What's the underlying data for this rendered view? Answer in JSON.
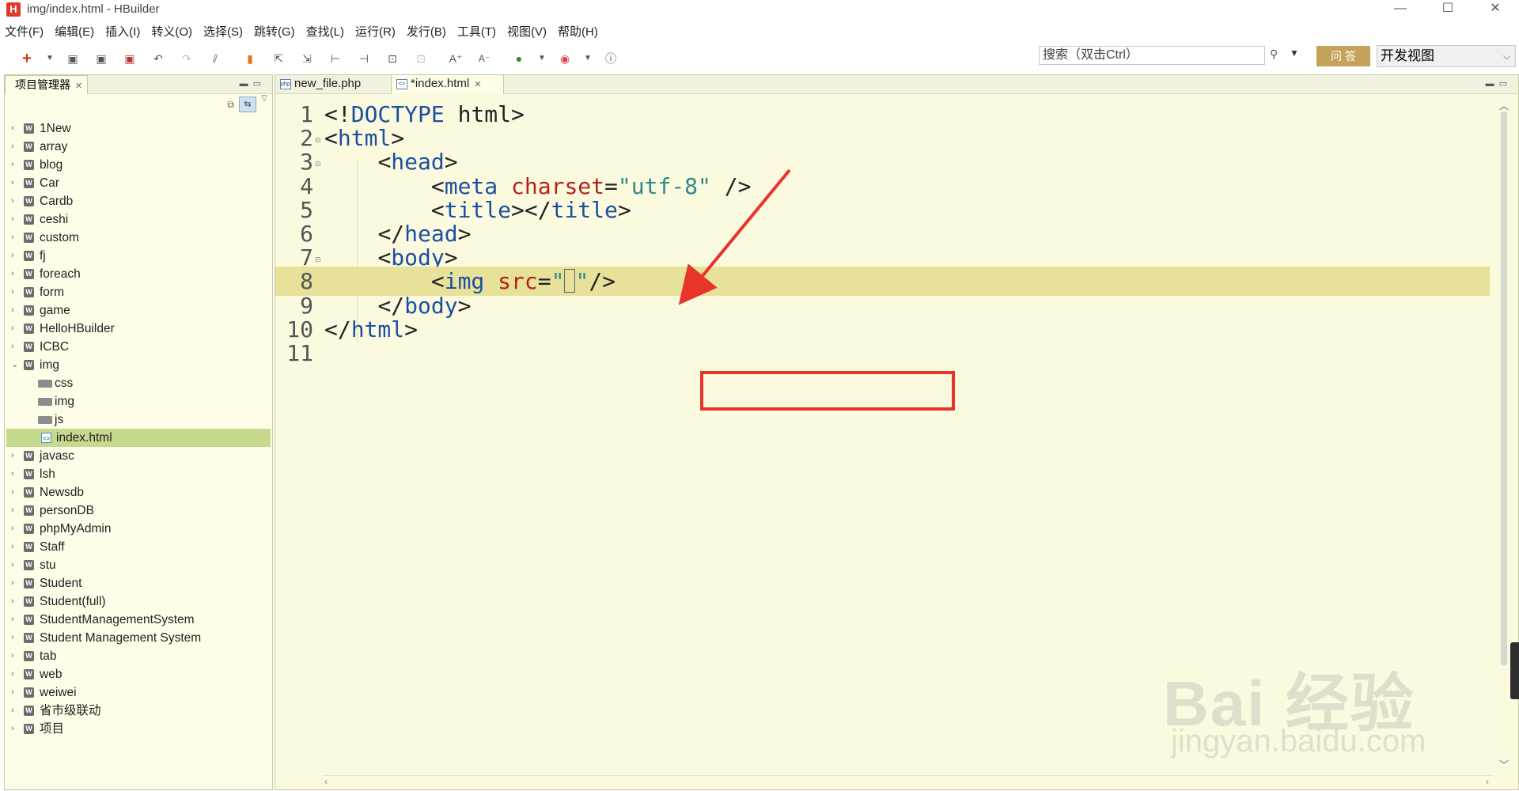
{
  "window": {
    "title": "img/index.html - HBuilder",
    "app_icon": "H",
    "controls": [
      "—",
      "☐",
      "✕"
    ]
  },
  "menu": [
    "文件(F)",
    "编辑(E)",
    "插入(I)",
    "转义(O)",
    "选择(S)",
    "跳转(G)",
    "查找(L)",
    "运行(R)",
    "发行(B)",
    "工具(T)",
    "视图(V)",
    "帮助(H)"
  ],
  "toolbar": {
    "search_placeholder": "搜索（双击Ctrl）",
    "ask_label": "问 答",
    "view_select": "开发视图"
  },
  "project_manager": {
    "tab_label": "项目管理器",
    "tree": [
      {
        "label": "1New",
        "type": "project",
        "expanded": false
      },
      {
        "label": "array",
        "type": "project",
        "expanded": false
      },
      {
        "label": "blog",
        "type": "project",
        "expanded": false
      },
      {
        "label": "Car",
        "type": "project",
        "expanded": false
      },
      {
        "label": "Cardb",
        "type": "project",
        "expanded": false
      },
      {
        "label": "ceshi",
        "type": "project",
        "expanded": false
      },
      {
        "label": "custom",
        "type": "project",
        "expanded": false
      },
      {
        "label": "fj",
        "type": "project",
        "expanded": false
      },
      {
        "label": "foreach",
        "type": "project",
        "expanded": false
      },
      {
        "label": "form",
        "type": "project",
        "expanded": false
      },
      {
        "label": "game",
        "type": "project",
        "expanded": false
      },
      {
        "label": "HelloHBuilder",
        "type": "project",
        "expanded": false
      },
      {
        "label": "ICBC",
        "type": "project",
        "expanded": false
      },
      {
        "label": "img",
        "type": "project",
        "expanded": true
      },
      {
        "label": "css",
        "type": "folder"
      },
      {
        "label": "img",
        "type": "folder"
      },
      {
        "label": "js",
        "type": "folder"
      },
      {
        "label": "index.html",
        "type": "file",
        "selected": true
      },
      {
        "label": "javasc",
        "type": "project",
        "expanded": false
      },
      {
        "label": "lsh",
        "type": "project",
        "expanded": false
      },
      {
        "label": "Newsdb",
        "type": "project",
        "expanded": false
      },
      {
        "label": "personDB",
        "type": "project",
        "expanded": false
      },
      {
        "label": "phpMyAdmin",
        "type": "project",
        "expanded": false
      },
      {
        "label": "Staff",
        "type": "project",
        "expanded": false
      },
      {
        "label": "stu",
        "type": "project",
        "expanded": false
      },
      {
        "label": "Student",
        "type": "project",
        "expanded": false
      },
      {
        "label": "Student(full)",
        "type": "project",
        "expanded": false
      },
      {
        "label": "StudentManagementSystem",
        "type": "project",
        "expanded": false
      },
      {
        "label": "Student Management System",
        "type": "project",
        "expanded": false
      },
      {
        "label": "tab",
        "type": "project",
        "expanded": false
      },
      {
        "label": "web",
        "type": "project",
        "expanded": false
      },
      {
        "label": "weiwei",
        "type": "project",
        "expanded": false
      },
      {
        "label": "省市级联动",
        "type": "project",
        "expanded": false
      },
      {
        "label": "项目",
        "type": "project",
        "expanded": false
      }
    ]
  },
  "editor": {
    "tabs": [
      {
        "label": "new_file.php",
        "active": false
      },
      {
        "label": "*index.html",
        "active": true
      }
    ],
    "current_line": 8,
    "lines": [
      {
        "n": "1",
        "text": "<!DOCTYPE html>"
      },
      {
        "n": "2",
        "text": "<html>"
      },
      {
        "n": "3",
        "text": "    <head>"
      },
      {
        "n": "4",
        "text": "        <meta charset=\"utf-8\" />"
      },
      {
        "n": "5",
        "text": "        <title></title>"
      },
      {
        "n": "6",
        "text": "    </head>"
      },
      {
        "n": "7",
        "text": "    <body>"
      },
      {
        "n": "8",
        "text": "        <img src=\"\"/>"
      },
      {
        "n": "9",
        "text": "    </body>"
      },
      {
        "n": "10",
        "text": "</html>"
      },
      {
        "n": "11",
        "text": ""
      }
    ]
  },
  "watermark": {
    "main": "Bai 经验",
    "sub": "jingyan.baidu.com"
  },
  "colors": {
    "annotation": "#e8342b",
    "current_line": "#e7e19a",
    "editor_bg": "#fbfade",
    "tag": "#1c4fa0",
    "attr": "#b3231d",
    "string": "#2b8a8a"
  }
}
